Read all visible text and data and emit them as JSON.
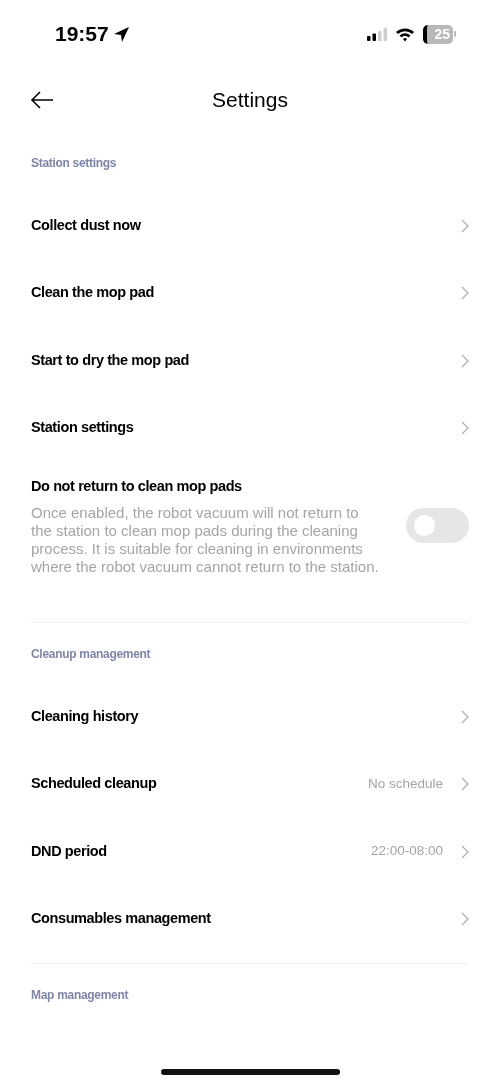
{
  "status_bar": {
    "time": "19:57",
    "battery": "25"
  },
  "header": {
    "title": "Settings"
  },
  "sections": [
    {
      "label": "Station settings",
      "items": [
        {
          "kind": "link",
          "title": "Collect dust now"
        },
        {
          "kind": "link",
          "title": "Clean the mop pad"
        },
        {
          "kind": "link",
          "title": "Start to dry the mop pad"
        },
        {
          "kind": "link",
          "title": "Station settings"
        },
        {
          "kind": "toggle",
          "title": "Do not return to clean mop pads",
          "description": "Once enabled, the robot vacuum will not return to the station to clean mop pads during the cleaning process. It is suitable for cleaning in environments where the robot vacuum cannot return to the station.",
          "on": false
        }
      ]
    },
    {
      "label": "Cleanup management",
      "items": [
        {
          "kind": "link",
          "title": "Cleaning history"
        },
        {
          "kind": "link",
          "title": "Scheduled cleanup",
          "value": "No schedule"
        },
        {
          "kind": "link",
          "title": "DND period",
          "value": "22:00-08:00"
        },
        {
          "kind": "link",
          "title": "Consumables management"
        }
      ]
    },
    {
      "label": "Map management"
    }
  ]
}
